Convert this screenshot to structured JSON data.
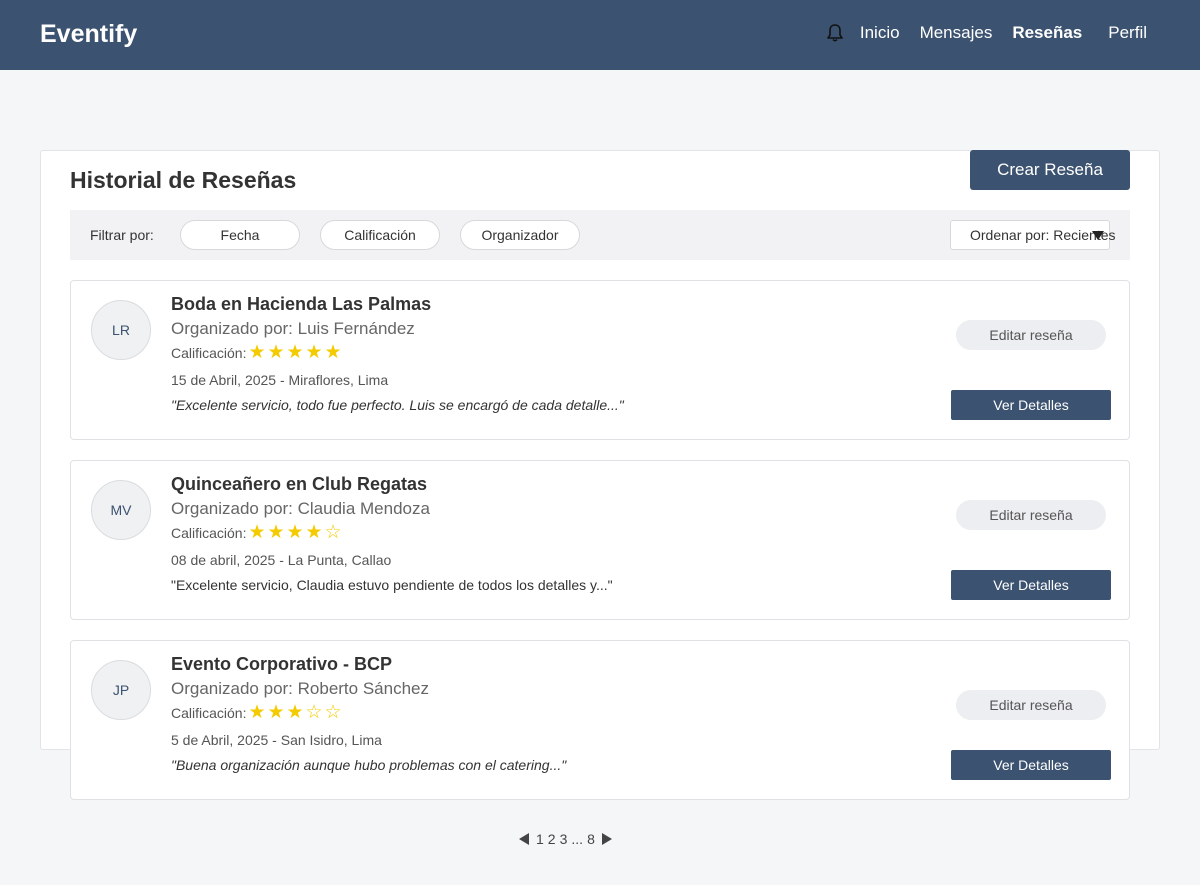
{
  "header": {
    "brand": "Eventify",
    "nav": [
      "Inicio",
      "Mensajes",
      "Reseñas",
      "Perfil"
    ],
    "active_nav": "Reseñas"
  },
  "page": {
    "title": "Historial de Reseñas",
    "create_button": "Crear Reseña"
  },
  "filters": {
    "label": "Filtrar por:",
    "chips": [
      "Fecha",
      "Calificación",
      "Organizador"
    ],
    "sort_label": "Ordenar por: Recientes"
  },
  "reviews": [
    {
      "initials": "LR",
      "title": "Boda en Hacienda Las Palmas",
      "organizer": "Organizado por: Luis Fernández",
      "rating_label": "Calificación:",
      "stars": "★★★★★",
      "rating": 5,
      "date_location": "15 de Abril, 2025 - Miraflores, Lima",
      "quote": "\"Excelente servicio, todo fue perfecto. Luis se encargó de cada detalle...\"",
      "edit_label": "Editar reseña",
      "details_label": "Ver Detalles"
    },
    {
      "initials": "MV",
      "title": "Quinceañero en Club Regatas",
      "organizer": "Organizado por: Claudia Mendoza",
      "rating_label": "Calificación:",
      "stars": "★★★★☆",
      "rating": 4,
      "date_location": "08 de abril, 2025 - La Punta, Callao",
      "quote": "\"Excelente servicio, Claudia estuvo pendiente de todos los detalles y...\"",
      "edit_label": "Editar reseña",
      "details_label": "Ver Detalles"
    },
    {
      "initials": "JP",
      "title": "Evento Corporativo - BCP",
      "organizer": "Organizado por: Roberto Sánchez",
      "rating_label": "Calificación:",
      "stars": "★★★☆☆",
      "rating": 3,
      "date_location": "5 de Abril, 2025 - San Isidro, Lima",
      "quote": "\"Buena organización aunque hubo problemas con el catering...\"",
      "edit_label": "Editar reseña",
      "details_label": "Ver Detalles"
    }
  ],
  "pagination": {
    "pages": [
      "1",
      "2",
      "3",
      "...",
      "8"
    ]
  },
  "colors": {
    "primary": "#3b5270",
    "star": "#f4cb00",
    "background": "#f5f6f8"
  }
}
